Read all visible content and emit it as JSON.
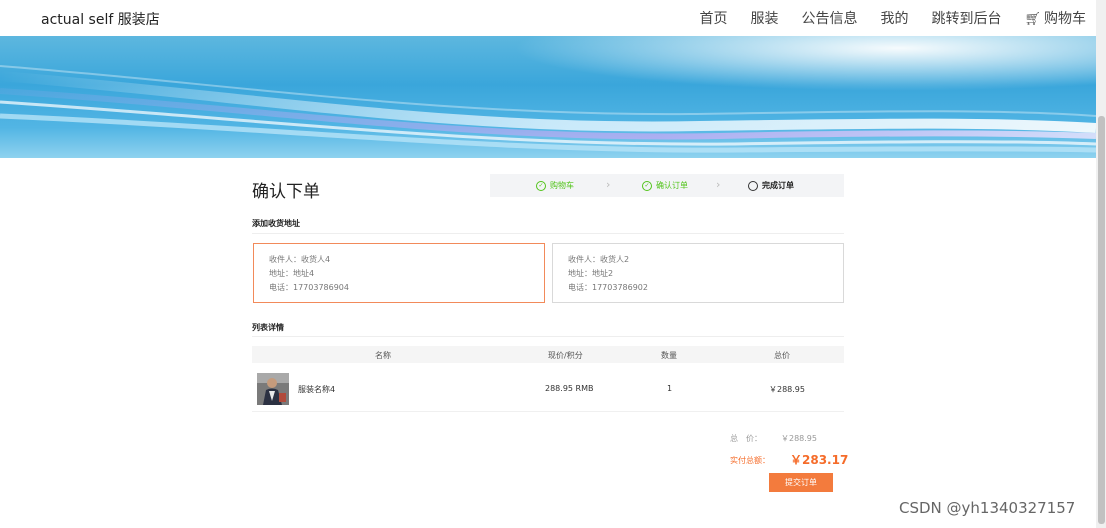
{
  "nav": {
    "brand": "actual self 服装店",
    "items": [
      "首页",
      "服装",
      "公告信息",
      "我的",
      "跳转到后台"
    ],
    "cart_label": "购物车"
  },
  "page": {
    "title": "确认下单"
  },
  "steps": [
    {
      "label": "购物车",
      "status": "done"
    },
    {
      "label": "确认订单",
      "status": "done"
    },
    {
      "label": "完成订单",
      "status": "current"
    }
  ],
  "address_section": {
    "label": "添加收货地址",
    "cards": [
      {
        "recipient_label": "收件人：",
        "recipient": "收货人4",
        "address_label": "地址：",
        "address": "地址4",
        "phone_label": "电话：",
        "phone": "17703786904",
        "selected": true
      },
      {
        "recipient_label": "收件人：",
        "recipient": "收货人2",
        "address_label": "地址：",
        "address": "地址2",
        "phone_label": "电话：",
        "phone": "17703786902",
        "selected": false
      }
    ]
  },
  "list_section": {
    "label": "列表详情",
    "columns": [
      "名称",
      "现价/积分",
      "数量",
      "总价"
    ],
    "rows": [
      {
        "name": "服装名称4",
        "price": "288.95 RMB",
        "qty": "1",
        "total": "￥288.95"
      }
    ]
  },
  "summary": {
    "total_label": "总　价：",
    "total_value": "￥288.95",
    "pay_label": "实付总额：",
    "pay_value": "￥283.17",
    "submit_label": "提交订单"
  },
  "watermark": "CSDN @yh1340327157",
  "colors": {
    "accent": "#f37b3d",
    "success": "#52c41a",
    "selected_border": "#f28a5a"
  }
}
